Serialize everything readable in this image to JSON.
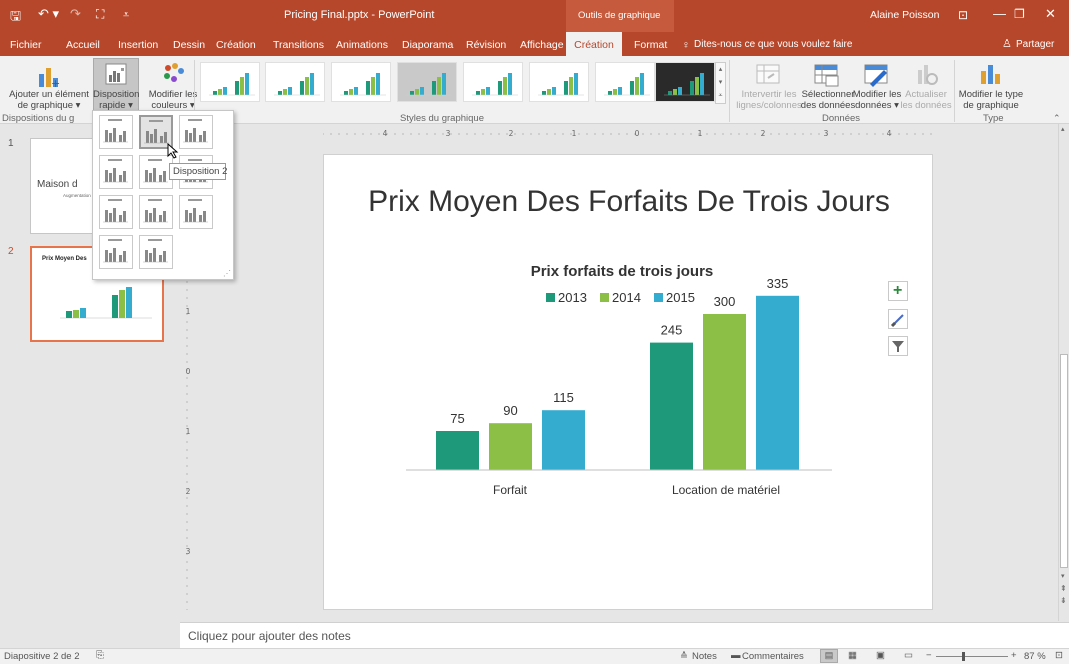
{
  "app": {
    "title": "Pricing Final.pptx - PowerPoint",
    "context_header": "Outils de graphique",
    "user": "Alaine Poisson"
  },
  "tabs": [
    "Fichier",
    "Accueil",
    "Insertion",
    "Dessin",
    "Création",
    "Transitions",
    "Animations",
    "Diaporama",
    "Révision",
    "Affichage"
  ],
  "ctx_tabs": {
    "active": "Création",
    "other": "Format"
  },
  "tellme": "Dites-nous ce que vous voulez faire",
  "share": "Partager",
  "ribbon": {
    "add_element": [
      "Ajouter un élément",
      "de graphique ▾"
    ],
    "quick_layout": [
      "Disposition",
      "rapide ▾"
    ],
    "change_colors": [
      "Modifier les",
      "couleurs ▾"
    ],
    "switch_rowcol": [
      "Intervertir les",
      "lignes/colonnes"
    ],
    "select_data": [
      "Sélectionner",
      "des données"
    ],
    "edit_data": [
      "Modifier les",
      "données ▾"
    ],
    "refresh": [
      "Actualiser",
      "les données"
    ],
    "change_type": [
      "Modifier le type",
      "de graphique"
    ],
    "groups": {
      "layouts": "Dispositions du g",
      "styles": "Styles du graphique",
      "data": "Données",
      "type": "Type"
    }
  },
  "tooltip": "Disposition 2",
  "thumbnails": [
    {
      "num": "1",
      "title": "Maison d",
      "subtitle": "Augmentation d"
    },
    {
      "num": "2",
      "title": "Prix Moyen Des",
      "subtitle": "Prix forfa"
    }
  ],
  "ruler": {
    "h": [
      "4",
      "3",
      "2",
      "1",
      "0",
      "1",
      "2",
      "3",
      "4"
    ],
    "v": [
      "1",
      "0",
      "1",
      "2",
      "3"
    ]
  },
  "slide": {
    "title": "Prix Moyen Des Forfaits De Trois Jours"
  },
  "chart_data": {
    "type": "bar",
    "title": "Prix forfaits de trois jours",
    "categories": [
      "Forfait",
      "Location de matériel"
    ],
    "series": [
      {
        "name": "2013",
        "values": [
          75,
          245
        ],
        "color": "#1e9a7a"
      },
      {
        "name": "2014",
        "values": [
          90,
          300
        ],
        "color": "#8cbf45"
      },
      {
        "name": "2015",
        "values": [
          115,
          335
        ],
        "color": "#34acd0"
      }
    ],
    "ylim": [
      0,
      350
    ],
    "legend": "top",
    "grid": false
  },
  "notes": "Cliquez pour ajouter des notes",
  "status": {
    "slide": "Diapositive 2 de 2",
    "notes": "Notes",
    "comments": "Commentaires",
    "zoom": "87 %"
  }
}
